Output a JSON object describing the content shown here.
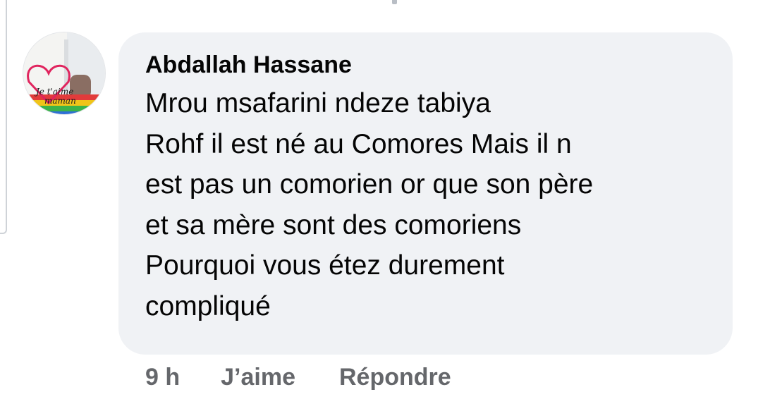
{
  "comment": {
    "author": "Abdallah Hassane",
    "avatar_text": [
      "Je t'aime",
      "maman"
    ],
    "lines": [
      "Mrou msafarini ndeze tabiya",
      "Rohf il est né au Comores Mais il n",
      "est pas un comorien or que son père",
      "et sa mère sont des comoriens",
      "Pourquoi vous étez durement",
      "compliqué"
    ]
  },
  "actions": {
    "time": "9 h",
    "like_label": "J’aime",
    "reply_label": "Répondre"
  },
  "colors": {
    "bubble_bg": "#f0f2f5",
    "text": "#050505",
    "meta": "#65676b"
  }
}
